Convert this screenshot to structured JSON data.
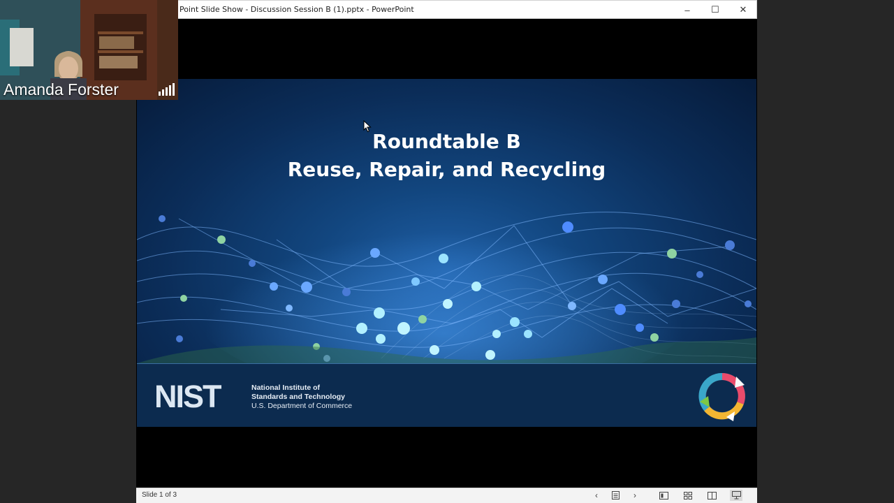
{
  "window": {
    "title": "Point Slide Show  -  Discussion Session B (1).pptx  -  PowerPoint",
    "controls": {
      "minimize": "–",
      "maximize": "☐",
      "close": "✕"
    }
  },
  "slide": {
    "title_line1": "Roundtable B",
    "title_line2": "Reuse, Repair, and Recycling",
    "logo_text": "NIST",
    "org_line1": "National Institute of",
    "org_line2": "Standards and Technology",
    "org_line3": "U.S. Department of Commerce"
  },
  "statusbar": {
    "slide_counter": "Slide 1 of 3",
    "icons": [
      "prev-icon",
      "notes-icon",
      "next-icon",
      "normal-view-icon",
      "slide-sorter-icon",
      "reading-view-icon",
      "slideshow-icon"
    ]
  },
  "video": {
    "participant_name": "Amanda Forster"
  },
  "colors": {
    "slide_bg": "#0b2d59",
    "accent": "#1f5fa6"
  }
}
